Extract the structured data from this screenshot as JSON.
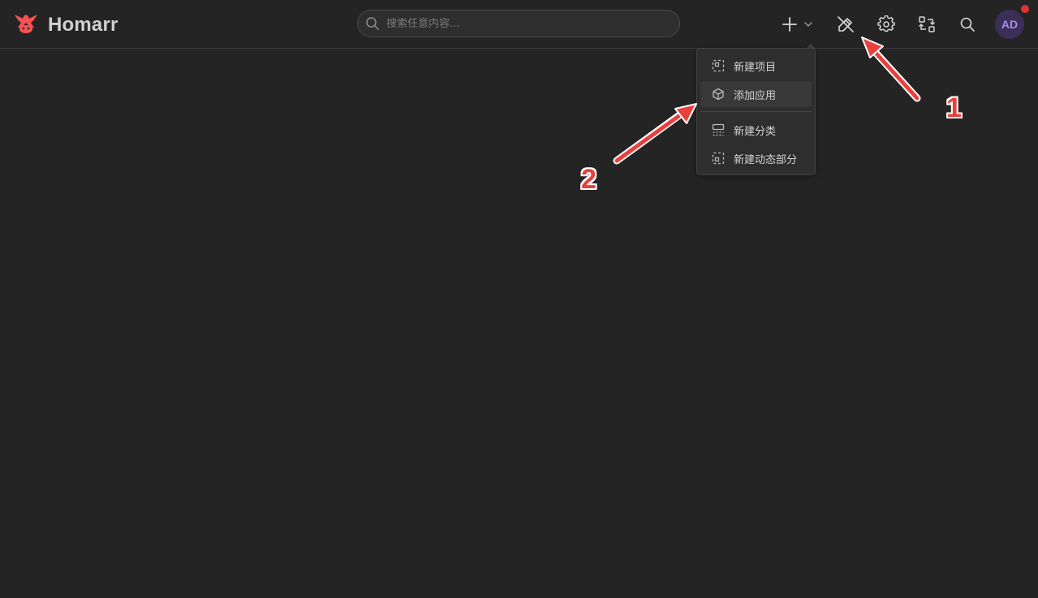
{
  "app": {
    "title": "Homarr",
    "brand_color": "#fa5252"
  },
  "search": {
    "placeholder": "搜索任意内容..."
  },
  "toolbar": {
    "icons": [
      "plus-icon",
      "chevron-down-icon",
      "pencil-off-icon",
      "gear-icon",
      "swap-icon",
      "search-icon"
    ]
  },
  "user": {
    "initials": "AD",
    "notification": true
  },
  "add_menu": {
    "items": [
      {
        "label": "新建项目",
        "icon": "dashed-square-icon"
      },
      {
        "label": "添加应用",
        "icon": "cube-icon"
      },
      {
        "label": "新建分类",
        "icon": "category-icon"
      },
      {
        "label": "新建动态部分",
        "icon": "dashed-square-icon"
      }
    ]
  },
  "annotations": [
    {
      "label": "1",
      "color": "#e8403c"
    },
    {
      "label": "2",
      "color": "#e8403c"
    }
  ]
}
